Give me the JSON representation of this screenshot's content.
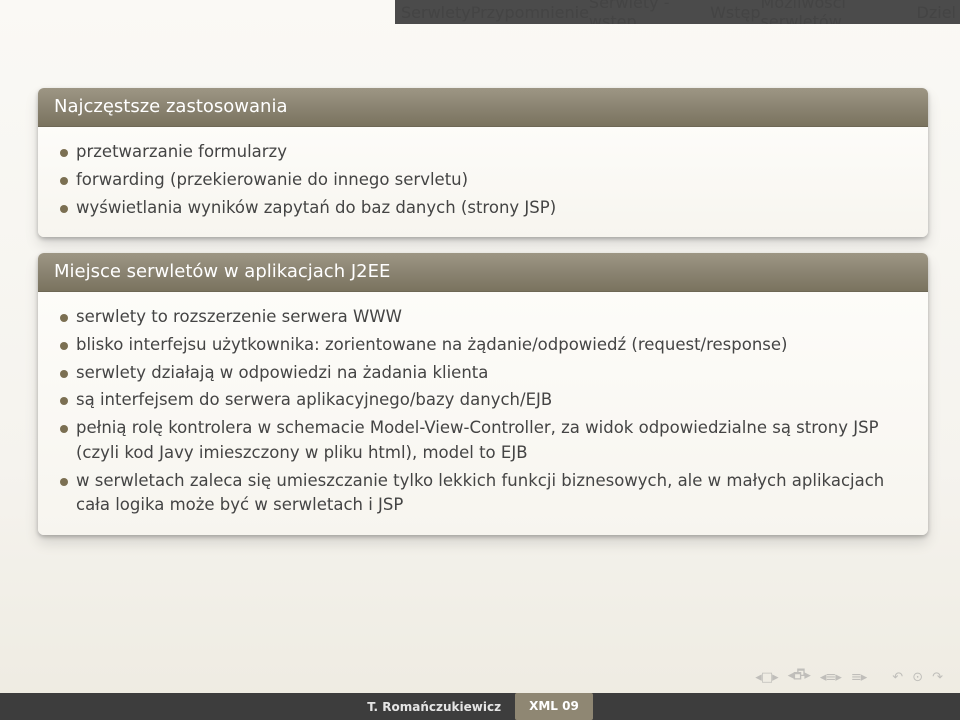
{
  "nav": {
    "items": [
      {
        "label": "Serwlety",
        "active": true
      },
      {
        "label": "Przypomnienie",
        "active": false
      },
      {
        "label": "Serwlety - wstęp",
        "active": false
      },
      {
        "label": "Wstęp",
        "active": false
      },
      {
        "label": "Możliwości serwletów",
        "active": false
      },
      {
        "label": "Dziel",
        "active": false
      }
    ]
  },
  "block1": {
    "title": "Najczęstsze zastosowania",
    "items": [
      "przetwarzanie formularzy",
      "forwarding (przekierowanie do innego servletu)",
      "wyświetlania wyników zapytań do baz danych (strony JSP)"
    ]
  },
  "block2": {
    "title": "Miejsce serwletów w aplikacjach J2EE",
    "items": [
      "serwlety to rozszerzenie serwera WWW",
      "blisko interfejsu użytkownika: zorientowane na żądanie/odpowiedź (request/response)",
      "serwlety działają w odpowiedzi na żadania klienta",
      "są interfejsem do serwera aplikacyjnego/bazy danych/EJB",
      "pełnią rolę kontrolera w schemacie Model-View-Controller, za widok odpowiedzialne są strony JSP (czyli kod Javy imieszczony w pliku html), model to EJB",
      "w serwletach zaleca się umieszczanie tylko lekkich funkcji biznesowych, ale w małych aplikacjach cała logika może być w serwletach i JSP"
    ]
  },
  "footer": {
    "author": "T. Romańczukiewicz",
    "title": "XML 09"
  }
}
